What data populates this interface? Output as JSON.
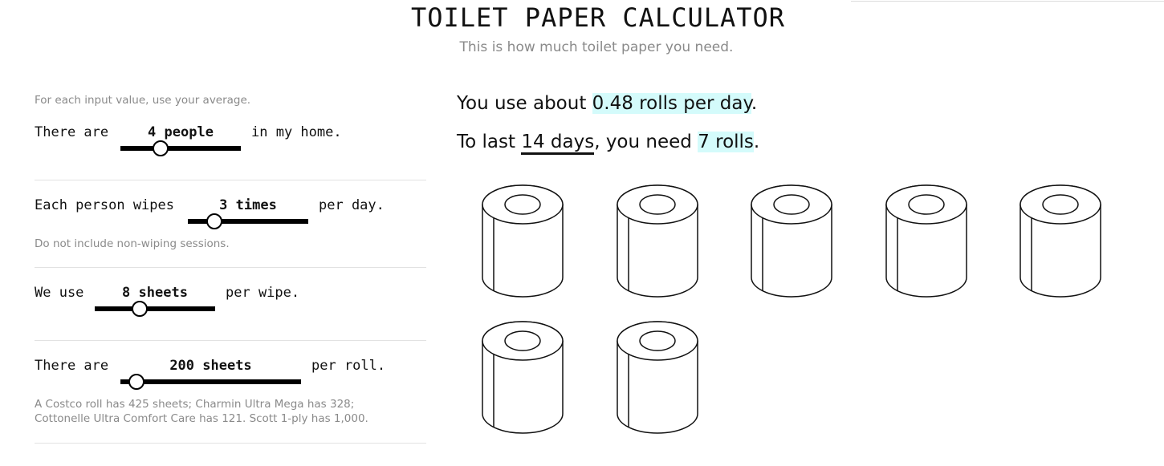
{
  "header": {
    "title": "TOILET PAPER CALCULATOR",
    "subtitle": "This is how much toilet paper you need."
  },
  "inputs": {
    "intro": "For each input value, use your average.",
    "people": {
      "prefix": "There are",
      "value": "4 people",
      "suffix": "in my home.",
      "level": 0.33
    },
    "wipes": {
      "prefix": "Each person wipes",
      "value": "3 times",
      "suffix": "per day.",
      "note": "Do not include non-wiping sessions.",
      "level": 0.22
    },
    "sheets_per_wipe": {
      "prefix": "We use",
      "value": "8 sheets",
      "suffix": "per wipe.",
      "level": 0.37
    },
    "sheets_per_roll": {
      "prefix": "There are",
      "value": "200 sheets",
      "suffix": "per roll.",
      "note": "A Costco roll has 425 sheets; Charmin Ultra Mega has 328; Cottonelle Ultra Comfort Care has 121. Scott 1-ply has 1,000.",
      "level": 0.09
    }
  },
  "results": {
    "line1_prefix": "You use about ",
    "rate": "0.48 rolls per day",
    "line1_suffix": ".",
    "line2_prefix": "To last ",
    "days": "14 days",
    "line2_mid": ", you need ",
    "rolls": "7 rolls",
    "line2_suffix": "."
  },
  "roll_count": 7,
  "roll_icon": "toilet-paper-roll-icon",
  "colors": {
    "highlight": "#d4fbfb",
    "text": "#111111",
    "muted": "#8a8a8a"
  }
}
